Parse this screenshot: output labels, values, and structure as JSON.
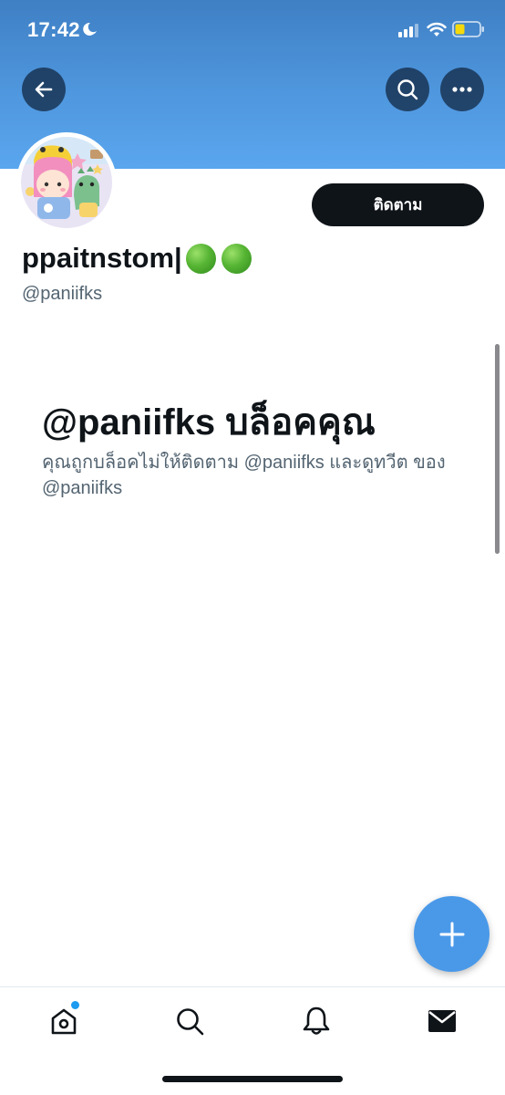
{
  "status_bar": {
    "time": "17:42"
  },
  "profile": {
    "display_name": "ppaitnstom|",
    "handle": "@paniifks",
    "follow_label": "ติดตาม"
  },
  "blocked": {
    "title": "@paniifks บล็อคคุณ",
    "message": "คุณถูกบล็อคไม่ให้ติดตาม @paniifks และดูทวีต ของ @paniifks"
  },
  "icons": {
    "back": "arrow-left",
    "search": "search",
    "more": "ellipsis",
    "compose": "plus",
    "home": "home",
    "notifications": "bell",
    "messages": "envelope"
  },
  "colors": {
    "banner": "#4f97de",
    "accent": "#4a99e9",
    "follow_button": "#0f1419",
    "notification_dot": "#1d9bf0"
  }
}
